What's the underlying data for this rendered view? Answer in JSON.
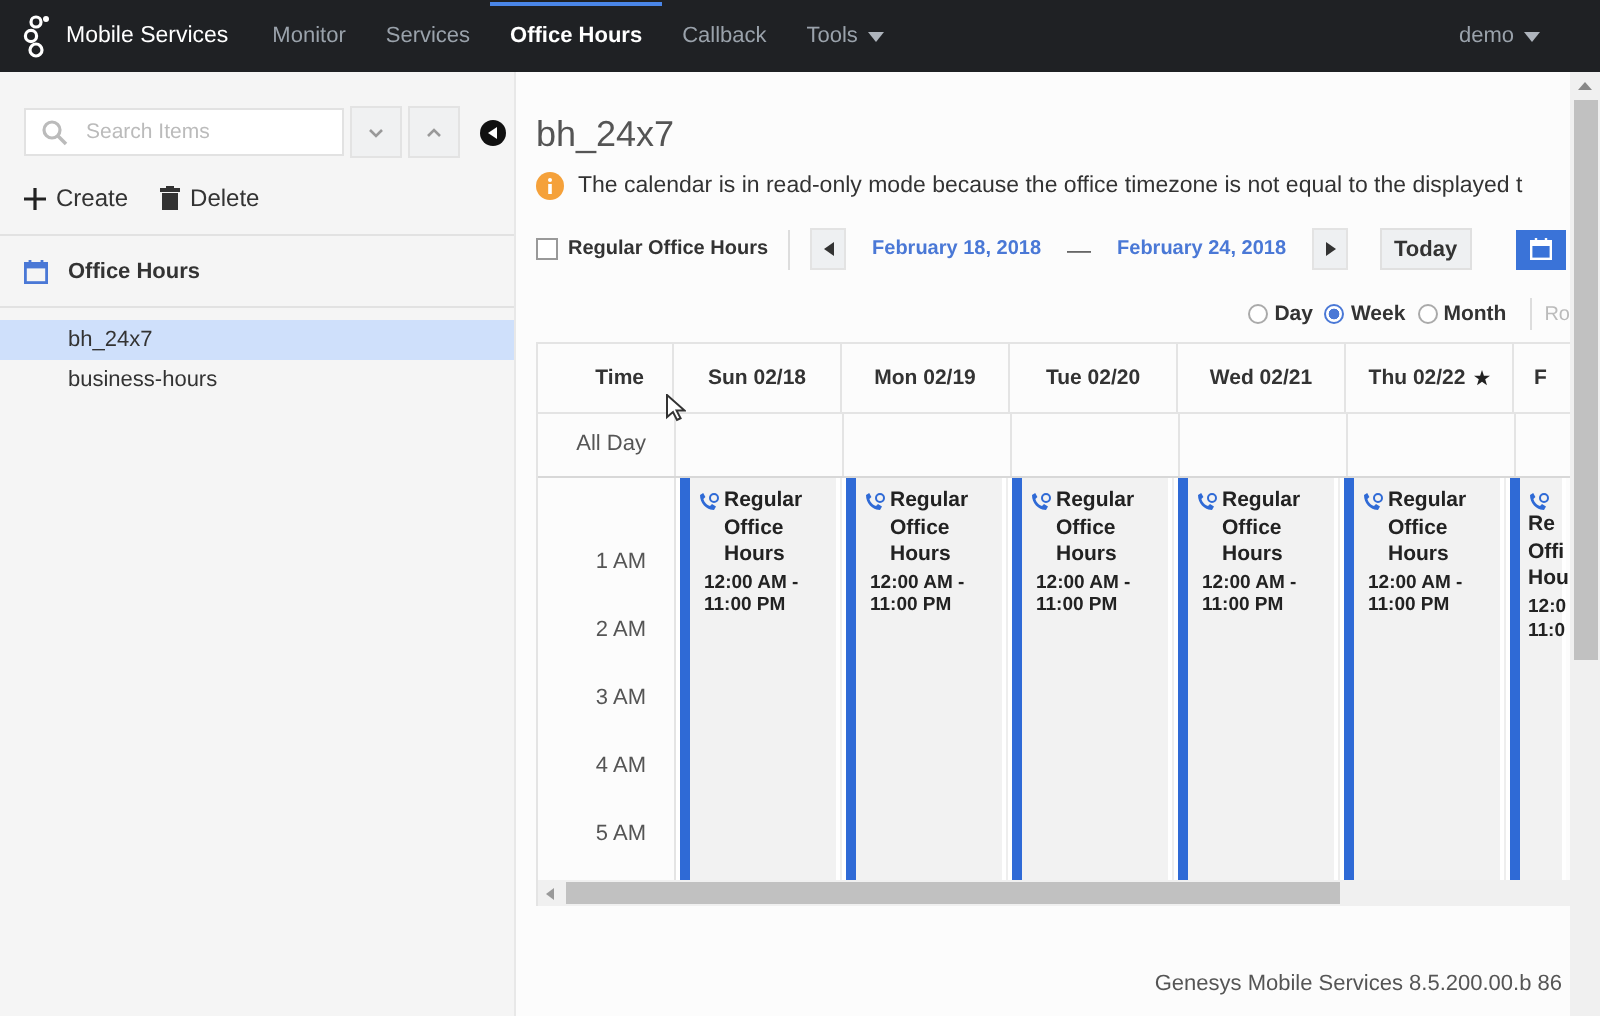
{
  "nav": {
    "brand": "Mobile Services",
    "items": [
      {
        "label": "Monitor",
        "selected": false,
        "dropdown": false
      },
      {
        "label": "Services",
        "selected": false,
        "dropdown": false
      },
      {
        "label": "Office Hours",
        "selected": true,
        "dropdown": false
      },
      {
        "label": "Callback",
        "selected": false,
        "dropdown": false
      },
      {
        "label": "Tools",
        "selected": false,
        "dropdown": true
      }
    ],
    "user": "demo"
  },
  "sidebar": {
    "search": {
      "placeholder": "Search Items"
    },
    "actions": [
      {
        "kind": "create",
        "label": "Create"
      },
      {
        "kind": "delete",
        "label": "Delete"
      }
    ],
    "section": "Office Hours",
    "items": [
      {
        "label": "bh_24x7",
        "selected": true
      },
      {
        "label": "business-hours",
        "selected": false
      }
    ]
  },
  "main": {
    "title": "bh_24x7",
    "notice": "The calendar is in read-only mode because the office timezone is not equal to the displayed t",
    "toolbar": {
      "filter": {
        "label": "Regular Office Hours",
        "checked": false
      },
      "start": "February 18, 2018",
      "separator": "—",
      "end": "February 24, 2018",
      "today": "Today"
    },
    "views": [
      {
        "label": "Day",
        "selected": false
      },
      {
        "label": "Week",
        "selected": true
      },
      {
        "label": "Month",
        "selected": false
      }
    ],
    "cut_control": "Ro",
    "calendar": {
      "time_header": "Time",
      "all_day": "All Day",
      "hours": [
        "1 AM",
        "2 AM",
        "3 AM",
        "4 AM",
        "5 AM"
      ],
      "days": [
        {
          "kind": "full",
          "label": "Sun 02/18",
          "marked": false,
          "event": {
            "title": "Regular Office Hours",
            "time": "12:00 AM - 11:00 PM"
          }
        },
        {
          "kind": "full",
          "label": "Mon 02/19",
          "marked": false,
          "event": {
            "title": "Regular Office Hours",
            "time": "12:00 AM - 11:00 PM"
          }
        },
        {
          "kind": "full",
          "label": "Tue 02/20",
          "marked": false,
          "event": {
            "title": "Regular Office Hours",
            "time": "12:00 AM - 11:00 PM"
          }
        },
        {
          "kind": "full",
          "label": "Wed 02/21",
          "marked": false,
          "event": {
            "title": "Regular Office Hours",
            "time": "12:00 AM - 11:00 PM"
          }
        },
        {
          "kind": "full",
          "label": "Thu 02/22",
          "marked": true,
          "event": {
            "title": "Regular Office Hours",
            "time": "12:00 AM - 11:00 PM"
          }
        },
        {
          "kind": "cut",
          "label": "F",
          "event": {
            "lines": [
              "Re",
              "Offi",
              "Hou",
              "12:0",
              "11:0"
            ]
          }
        }
      ]
    },
    "footer": "Genesys Mobile Services 8.5.200.00.b 86"
  }
}
